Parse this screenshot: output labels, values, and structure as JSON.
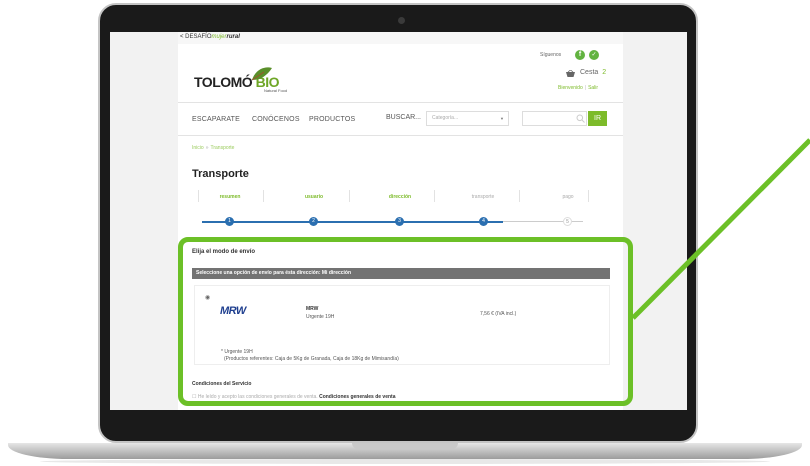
{
  "header": {
    "desafio_prefix": "< DESAFÍO",
    "desafio_mujer": "mujer",
    "desafio_rural": "rural",
    "logo_main": "TOLOMÓ ",
    "logo_bio": "BIO",
    "logo_tagline": "Natural Food",
    "follow_text": "Síguenos",
    "facebook_glyph": "f",
    "cart_label": "Cesta",
    "cart_count": "2",
    "welcome": "Bienvenido",
    "logout": "Salir"
  },
  "nav": {
    "items": [
      "ESCAPARATE",
      "CONÓCENOS",
      "PRODUCTOS"
    ],
    "search_label": "BUSCAR...",
    "category_placeholder": "Categoría...",
    "go_button": "IR"
  },
  "breadcrumb": {
    "home": "Inicio",
    "separator": "»",
    "current": "Transporte"
  },
  "page_title": "Transporte",
  "steps": [
    {
      "label": "resumen",
      "number": "1",
      "done": true
    },
    {
      "label": "usuario",
      "number": "2",
      "done": true
    },
    {
      "label": "dirección",
      "number": "3",
      "done": true
    },
    {
      "label": "transporte",
      "number": "4",
      "done": true
    },
    {
      "label": "pago",
      "number": "5",
      "done": false
    }
  ],
  "shipping": {
    "heading": "Elija el modo de envío",
    "bar_text": "Seleccione una opción de envío para ésta dirección: Mi dirección",
    "carrier_logo": "MRW",
    "carrier_name": "MRW",
    "carrier_service": "Urgente 19H",
    "price": "7,56 € (IVA incl.)",
    "note_title": "* Urgente 19H",
    "note_products": "(Productos referentes: Caja de 5Kg de Granada, Caja de 18Kg de Mimisandía)"
  },
  "conditions": {
    "heading": "Condiciones del Servicio",
    "accept_text": "He leído y acepto las condiciones generales de venta.",
    "link_text": "Condiciones generales de venta"
  },
  "colors": {
    "accent": "#7dbb2a",
    "highlight": "#6cc027",
    "step_blue": "#2b6fb0",
    "bar_gray": "#737373"
  }
}
